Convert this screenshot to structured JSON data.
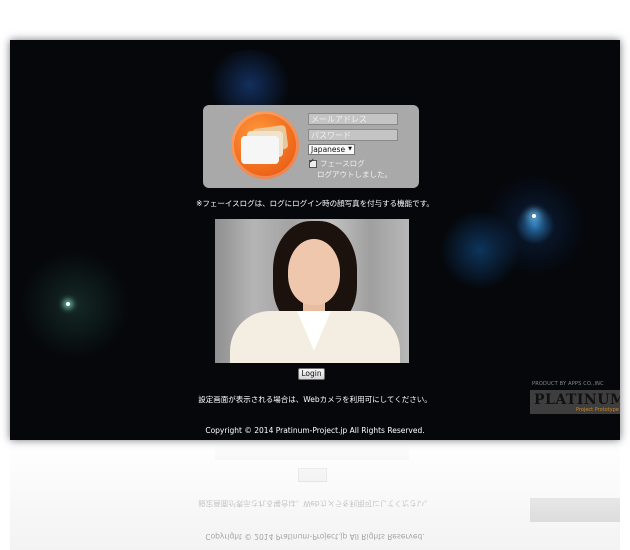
{
  "login": {
    "email_placeholder": "メールアドレス",
    "password_placeholder": "パスワード",
    "language_selected": "Japanese",
    "face_login_label": "フェースログ",
    "logout_message": "ログアウトしました。"
  },
  "notes": {
    "face_log_info": "※フェーイスログは、ログにログイン時の顔写真を付与する機能です。",
    "camera_info": "設定画面が表示される場合は、Webカメラを利用可にしてください。"
  },
  "buttons": {
    "login_label": "Login"
  },
  "footer": {
    "copyright": "Copyright © 2014 Pratinum-Project.jp All Rights Reserved."
  },
  "brand": {
    "product_by": "PRODUCT BY APPS CO.,INC",
    "name": "PLATINUM",
    "subtitle": "Project Prototype"
  },
  "colors": {
    "panel": "#a9a9a9",
    "logo_orange": "#f06a1c",
    "background": "#05070b"
  }
}
